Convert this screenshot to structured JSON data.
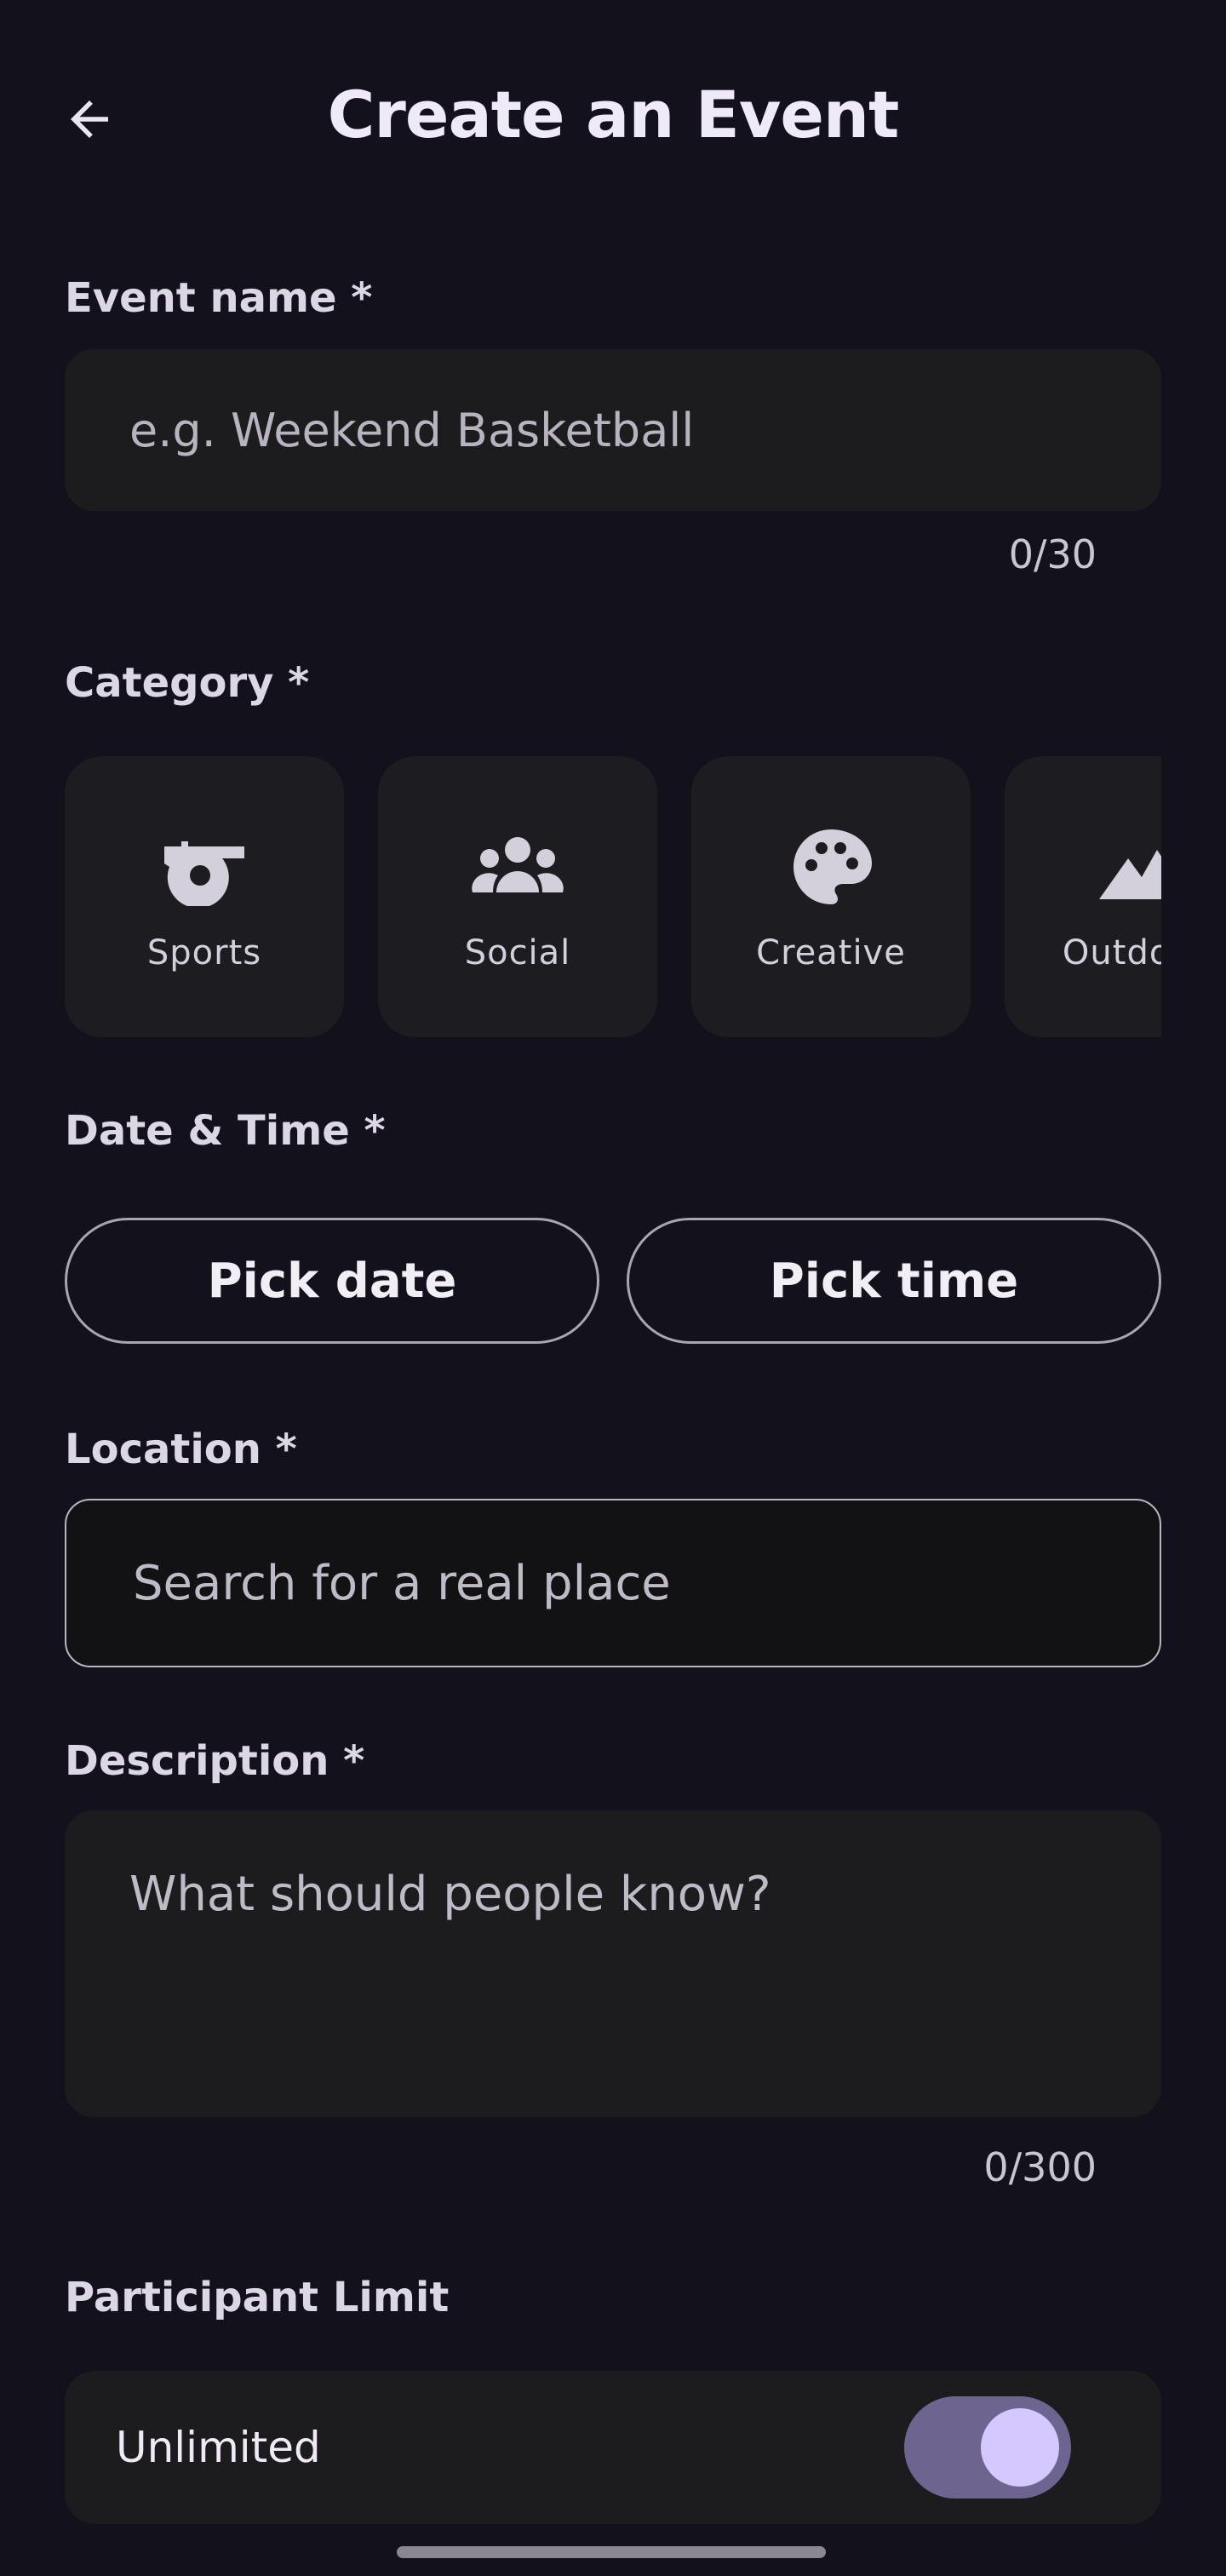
{
  "header": {
    "title": "Create an Event",
    "back_icon": "arrow-left-icon"
  },
  "event_name": {
    "label": "Event name *",
    "placeholder": "e.g. Weekend Basketball",
    "counter": "0/30"
  },
  "category": {
    "label": "Category *",
    "items": [
      {
        "label": "Sports",
        "icon": "whistle-icon"
      },
      {
        "label": "Social",
        "icon": "people-group-icon"
      },
      {
        "label": "Creative",
        "icon": "palette-icon"
      },
      {
        "label": "Outdoors",
        "icon": "mountain-icon"
      }
    ]
  },
  "datetime": {
    "label": "Date & Time *",
    "date_button": "Pick date",
    "time_button": "Pick time"
  },
  "location": {
    "label": "Location *",
    "placeholder": "Search for a real place"
  },
  "description": {
    "label": "Description *",
    "placeholder": "What should people know?",
    "counter": "0/300"
  },
  "participant_limit": {
    "label": "Participant Limit",
    "option_label": "Unlimited",
    "toggle_on": true
  },
  "colors": {
    "background": "#13121c",
    "surface": "#1c1c1e",
    "toggle_track": "#6d6590",
    "toggle_knob": "#d4c8ff"
  }
}
